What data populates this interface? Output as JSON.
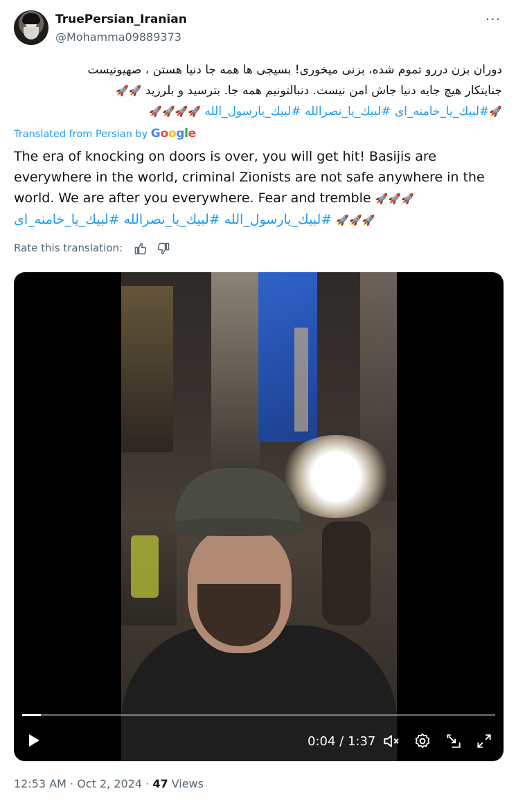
{
  "author": {
    "display_name": "TruePersian_Iranian",
    "handle": "@Mohamma09889373",
    "avatar_icon": "profile-avatar"
  },
  "more_icon": "more-options-icon",
  "original_text": {
    "line1": "دوران بزن دررو تموم شده، بزنی میخوری!  بسیجی ها همه جا دنیا هستن ، صهیونیست",
    "line2_text": "جنایتکار هیچ جایه دنیا جاش امن نیست. دنبالتونیم همه جا. بترسید و بلرزید",
    "line2_rockets": "🚀🚀",
    "line3_hashtags": [
      "#لبيك_يا_خامنه_ای",
      "#لبيك_يا_نصرالله",
      "#لبيك_يارسول_الله"
    ],
    "line3_rockets_before": "🚀",
    "line3_rockets_after": "🚀🚀🚀🚀"
  },
  "translation": {
    "label": "Translated from Persian by",
    "provider": "Google",
    "line1": "The era of knocking on doors is over, you will get hit! Basijis are",
    "line2": "everywhere in the world, criminal Zionists are not safe anywhere in the",
    "line3": "world. We are after you everywhere. Fear and tremble",
    "line3_rockets": "🚀🚀🚀",
    "line4_rockets": "🚀🚀🚀",
    "line4_hashtags": [
      "#لبيك_يارسول_الله",
      "#لبيك_يا_نصرالله",
      "#لبيك_يا_خامنه_ای"
    ]
  },
  "rate": {
    "label": "Rate this translation:",
    "up_icon": "thumbs-up-icon",
    "down_icon": "thumbs-down-icon"
  },
  "video": {
    "current_time": "0:04",
    "duration": "1:37",
    "progress": 0.04,
    "icons": [
      "play-icon",
      "mute-icon",
      "settings-icon",
      "pip-icon",
      "fullscreen-icon"
    ]
  },
  "meta": {
    "time": "12:53 AM",
    "date": "Oct 2, 2024",
    "views_count": "47",
    "views_label": "Views"
  }
}
